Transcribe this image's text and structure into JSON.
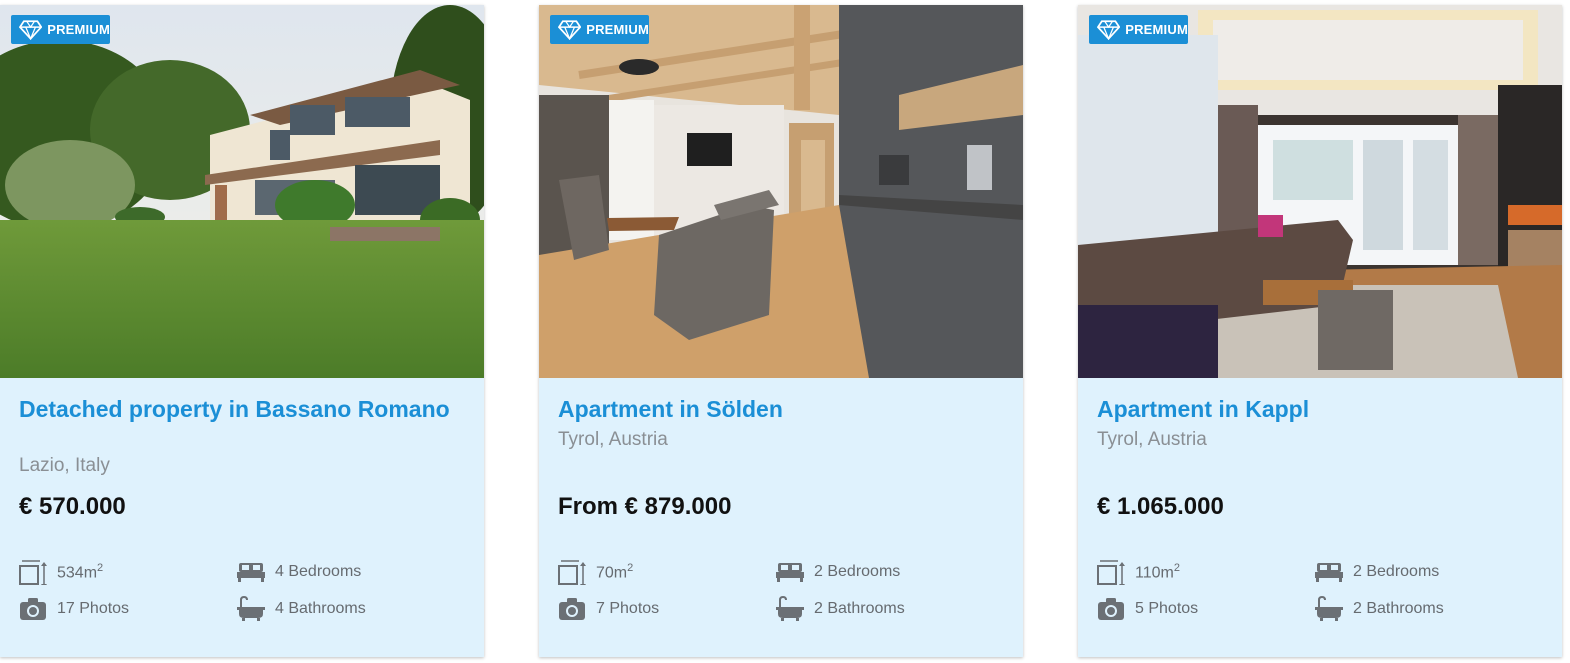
{
  "badge_label": "PREMIUM",
  "colors": {
    "accent": "#1b8fd6",
    "card_bg": "#dff2fd",
    "price": "#111111",
    "muted": "#8a8f94"
  },
  "icons": {
    "badge": "diamond-icon",
    "area": "area-icon",
    "photos": "camera-icon",
    "bedrooms": "bed-icon",
    "bathrooms": "bathtub-icon"
  },
  "listings": [
    {
      "image": "garden-house-photo",
      "title": "Detached property in Bassano Romano",
      "location": "Lazio, Italy",
      "price": "€ 570.000",
      "area_value": "534m",
      "area_unit_sup": "2",
      "photos": "17 Photos",
      "bedrooms": "4 Bedrooms",
      "bathrooms": "4 Bathrooms"
    },
    {
      "image": "wooden-apartment-living-room-photo",
      "title": "Apartment in Sölden",
      "location": "Tyrol, Austria",
      "price": "From € 879.000",
      "area_value": "70m",
      "area_unit_sup": "2",
      "photos": "7 Photos",
      "bedrooms": "2 Bedrooms",
      "bathrooms": "2 Bathrooms"
    },
    {
      "image": "lounge-with-sofa-photo",
      "title": "Apartment in Kappl",
      "location": "Tyrol, Austria",
      "price": "€ 1.065.000",
      "area_value": "110m",
      "area_unit_sup": "2",
      "photos": "5 Photos",
      "bedrooms": "2 Bedrooms",
      "bathrooms": "2 Bathrooms"
    }
  ]
}
